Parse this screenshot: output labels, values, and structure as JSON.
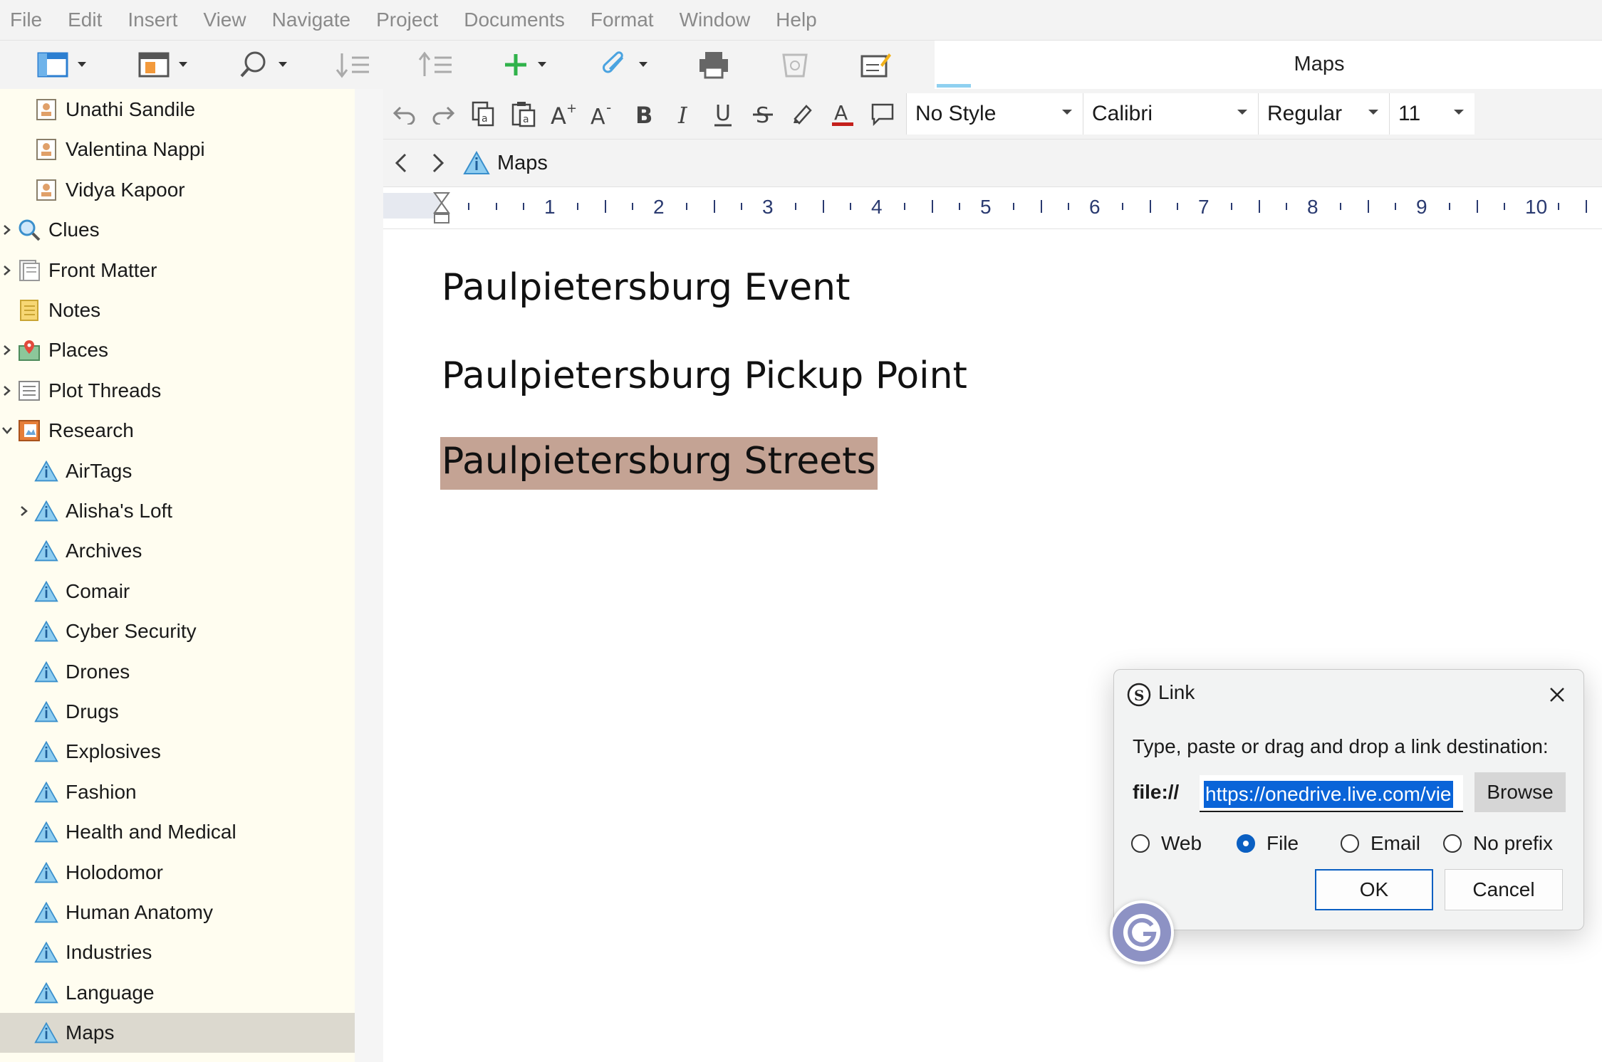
{
  "menu": [
    "File",
    "Edit",
    "Insert",
    "View",
    "Navigate",
    "Project",
    "Documents",
    "Format",
    "Window",
    "Help"
  ],
  "doc_tab": {
    "title": "Maps"
  },
  "binder": {
    "items": [
      {
        "label": "Unathi Sandile",
        "icon": "character-card-icon",
        "indent": 1,
        "chevron": ""
      },
      {
        "label": "Valentina Nappi",
        "icon": "character-card-icon",
        "indent": 1,
        "chevron": ""
      },
      {
        "label": "Vidya Kapoor",
        "icon": "character-card-icon",
        "indent": 1,
        "chevron": ""
      },
      {
        "label": "Clues",
        "icon": "magnifier-icon",
        "indent": 0,
        "chevron": "right"
      },
      {
        "label": "Front Matter",
        "icon": "front-matter-icon",
        "indent": 0,
        "chevron": "right"
      },
      {
        "label": "Notes",
        "icon": "notebook-icon",
        "indent": 0,
        "chevron": ""
      },
      {
        "label": "Places",
        "icon": "map-pin-icon",
        "indent": 0,
        "chevron": "right"
      },
      {
        "label": "Plot Threads",
        "icon": "list-icon",
        "indent": 0,
        "chevron": "right"
      },
      {
        "label": "Research",
        "icon": "research-book-icon",
        "indent": 0,
        "chevron": "down"
      },
      {
        "label": "AirTags",
        "icon": "info-triangle-icon",
        "indent": 1,
        "chevron": ""
      },
      {
        "label": "Alisha's Loft",
        "icon": "info-triangle-icon",
        "indent": 1,
        "chevron": "right"
      },
      {
        "label": "Archives",
        "icon": "info-triangle-icon",
        "indent": 1,
        "chevron": ""
      },
      {
        "label": "Comair",
        "icon": "info-triangle-icon",
        "indent": 1,
        "chevron": ""
      },
      {
        "label": "Cyber Security",
        "icon": "info-triangle-icon",
        "indent": 1,
        "chevron": ""
      },
      {
        "label": "Drones",
        "icon": "info-triangle-icon",
        "indent": 1,
        "chevron": ""
      },
      {
        "label": "Drugs",
        "icon": "info-triangle-icon",
        "indent": 1,
        "chevron": ""
      },
      {
        "label": "Explosives",
        "icon": "info-triangle-icon",
        "indent": 1,
        "chevron": ""
      },
      {
        "label": "Fashion",
        "icon": "info-triangle-icon",
        "indent": 1,
        "chevron": ""
      },
      {
        "label": "Health and Medical",
        "icon": "info-triangle-icon",
        "indent": 1,
        "chevron": ""
      },
      {
        "label": "Holodomor",
        "icon": "info-triangle-icon",
        "indent": 1,
        "chevron": ""
      },
      {
        "label": "Human Anatomy",
        "icon": "info-triangle-icon",
        "indent": 1,
        "chevron": ""
      },
      {
        "label": "Industries",
        "icon": "info-triangle-icon",
        "indent": 1,
        "chevron": ""
      },
      {
        "label": "Language",
        "icon": "info-triangle-icon",
        "indent": 1,
        "chevron": ""
      },
      {
        "label": "Maps",
        "icon": "info-triangle-icon",
        "indent": 1,
        "chevron": "",
        "selected": true
      }
    ]
  },
  "format_bar": {
    "style": "No Style",
    "font": "Calibri",
    "weight": "Regular",
    "size": "11"
  },
  "nav": {
    "breadcrumb": "Maps"
  },
  "ruler": {
    "numbers": [
      "1",
      "2",
      "3",
      "4",
      "5",
      "6",
      "7",
      "8",
      "9",
      "10"
    ]
  },
  "editor": {
    "lines": [
      {
        "text": "Paulpietersburg Event",
        "highlighted": false
      },
      {
        "text": "Paulpietersburg Pickup Point",
        "highlighted": false
      },
      {
        "text": "Paulpietersburg Streets",
        "highlighted": true
      }
    ],
    "highlight_color": "#c4a394"
  },
  "link_dialog": {
    "title": "Link",
    "prompt": "Type, paste or drag and drop a link destination:",
    "prefix": "file://",
    "url_value": "https://onedrive.live.com/vie",
    "browse_label": "Browse",
    "options": [
      {
        "label": "Web",
        "checked": false
      },
      {
        "label": "File",
        "checked": true
      },
      {
        "label": "Email",
        "checked": false
      },
      {
        "label": "No prefix",
        "checked": false
      }
    ],
    "ok_label": "OK",
    "cancel_label": "Cancel"
  },
  "colors": {
    "accent": "#0a5fc2",
    "selection": "#0a64d8",
    "binder_bg": "#fffdf0",
    "binder_selected": "#dcd9cf"
  }
}
